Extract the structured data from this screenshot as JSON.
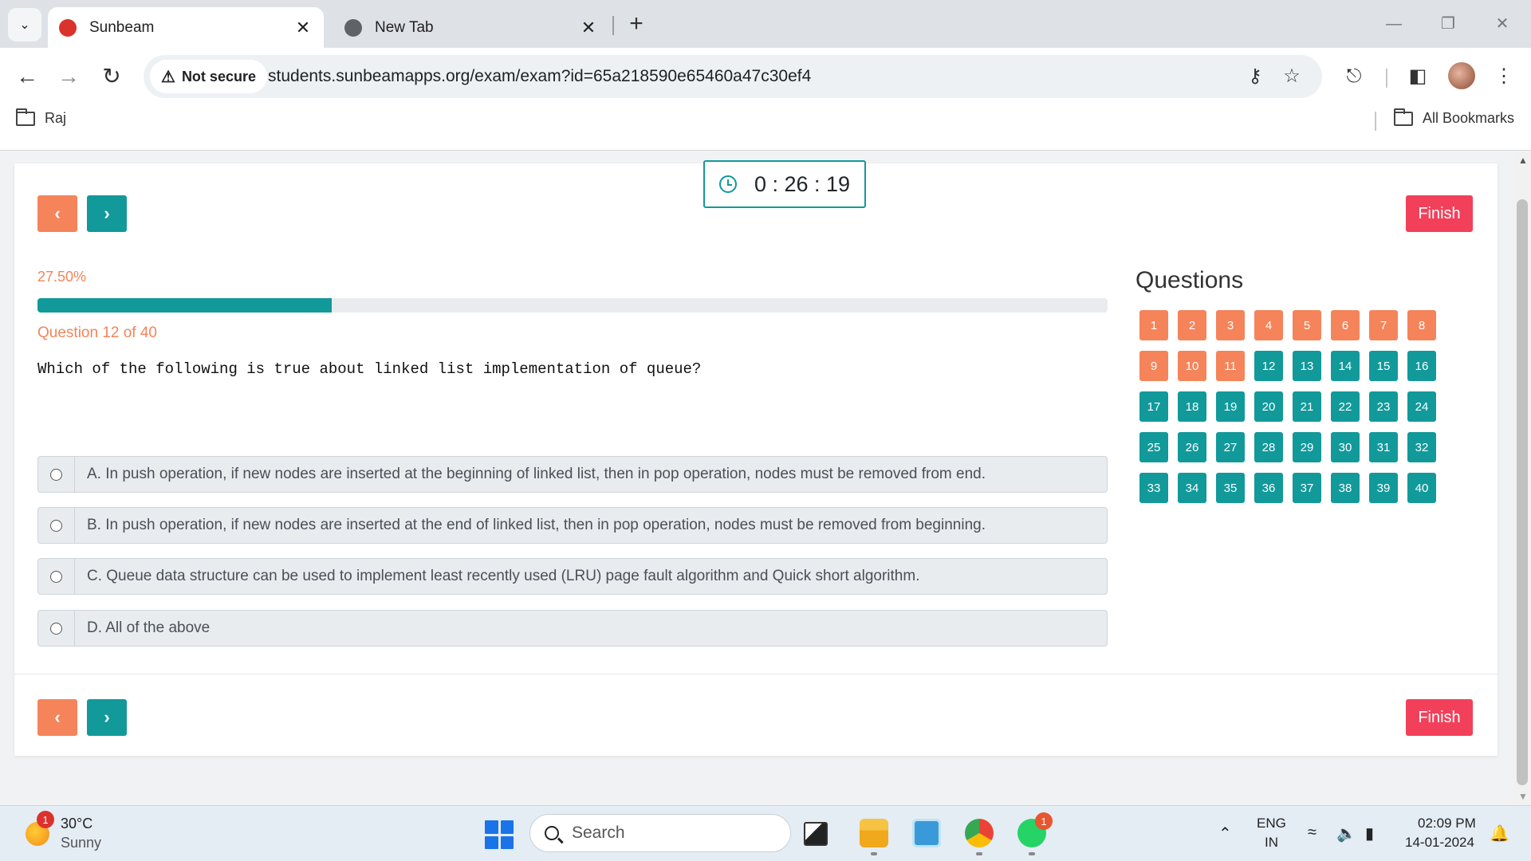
{
  "browser": {
    "tabs": [
      {
        "title": "Sunbeam",
        "active": true,
        "favicon_color": "#d9332c"
      },
      {
        "title": "New Tab",
        "active": false,
        "favicon_color": "#5f6368"
      }
    ],
    "new_tab_label": "+",
    "close_glyph": "✕",
    "security_label": "Not secure",
    "url": "students.sunbeamapps.org/exam/exam?id=65a218590e65460a47c30ef4",
    "bookmarks": {
      "left": "Raj",
      "right": "All Bookmarks"
    },
    "icons": [
      "back-arrow-icon",
      "forward-arrow-icon",
      "reload-icon",
      "password-key-icon",
      "star-icon",
      "extensions-icon",
      "side-panel-icon",
      "profile-avatar",
      "more-menu-icon"
    ]
  },
  "exam": {
    "timer": "0 : 26 : 19",
    "prev_glyph": "‹",
    "next_glyph": "›",
    "finish_label": "Finish",
    "progress_percent_text": "27.50%",
    "progress_value": 27.5,
    "question_counter": "Question 12 of 40",
    "question_text": "Which of the following is true about linked list implementation of queue?",
    "options": [
      "A. In push operation, if new nodes are inserted at the beginning of linked list, then in pop operation, nodes must be removed from end.",
      "B. In push operation, if new nodes are inserted at the end of linked list, then in pop operation, nodes must be removed from beginning.",
      "C. Queue data structure can be used to implement least recently used (LRU) page fault algorithm and Quick short algorithm.",
      "D. All of the above"
    ],
    "questions_title": "Questions",
    "questions": [
      {
        "n": "1",
        "status": "answered"
      },
      {
        "n": "2",
        "status": "answered"
      },
      {
        "n": "3",
        "status": "answered"
      },
      {
        "n": "4",
        "status": "answered"
      },
      {
        "n": "5",
        "status": "answered"
      },
      {
        "n": "6",
        "status": "answered"
      },
      {
        "n": "7",
        "status": "answered"
      },
      {
        "n": "8",
        "status": "answered"
      },
      {
        "n": "9",
        "status": "answered"
      },
      {
        "n": "10",
        "status": "answered"
      },
      {
        "n": "11",
        "status": "answered"
      },
      {
        "n": "12",
        "status": "pending"
      },
      {
        "n": "13",
        "status": "pending"
      },
      {
        "n": "14",
        "status": "pending"
      },
      {
        "n": "15",
        "status": "pending"
      },
      {
        "n": "16",
        "status": "pending"
      },
      {
        "n": "17",
        "status": "pending"
      },
      {
        "n": "18",
        "status": "pending"
      },
      {
        "n": "19",
        "status": "pending"
      },
      {
        "n": "20",
        "status": "pending"
      },
      {
        "n": "21",
        "status": "pending"
      },
      {
        "n": "22",
        "status": "pending"
      },
      {
        "n": "23",
        "status": "pending"
      },
      {
        "n": "24",
        "status": "pending"
      },
      {
        "n": "25",
        "status": "pending"
      },
      {
        "n": "26",
        "status": "pending"
      },
      {
        "n": "27",
        "status": "pending"
      },
      {
        "n": "28",
        "status": "pending"
      },
      {
        "n": "29",
        "status": "pending"
      },
      {
        "n": "30",
        "status": "pending"
      },
      {
        "n": "31",
        "status": "pending"
      },
      {
        "n": "32",
        "status": "pending"
      },
      {
        "n": "33",
        "status": "pending"
      },
      {
        "n": "34",
        "status": "pending"
      },
      {
        "n": "35",
        "status": "pending"
      },
      {
        "n": "36",
        "status": "pending"
      },
      {
        "n": "37",
        "status": "pending"
      },
      {
        "n": "38",
        "status": "pending"
      },
      {
        "n": "39",
        "status": "pending"
      },
      {
        "n": "40",
        "status": "pending"
      }
    ],
    "colors": {
      "accent_orange": "#f5845a",
      "accent_teal": "#12999a",
      "finish_red": "#f2405a"
    }
  },
  "taskbar": {
    "weather_badge": "1",
    "weather_temp": "30°C",
    "weather_desc": "Sunny",
    "search_placeholder": "Search",
    "whatsapp_badge": "1",
    "lang_top": "ENG",
    "lang_bottom": "IN",
    "time": "02:09 PM",
    "date": "14-01-2024"
  }
}
